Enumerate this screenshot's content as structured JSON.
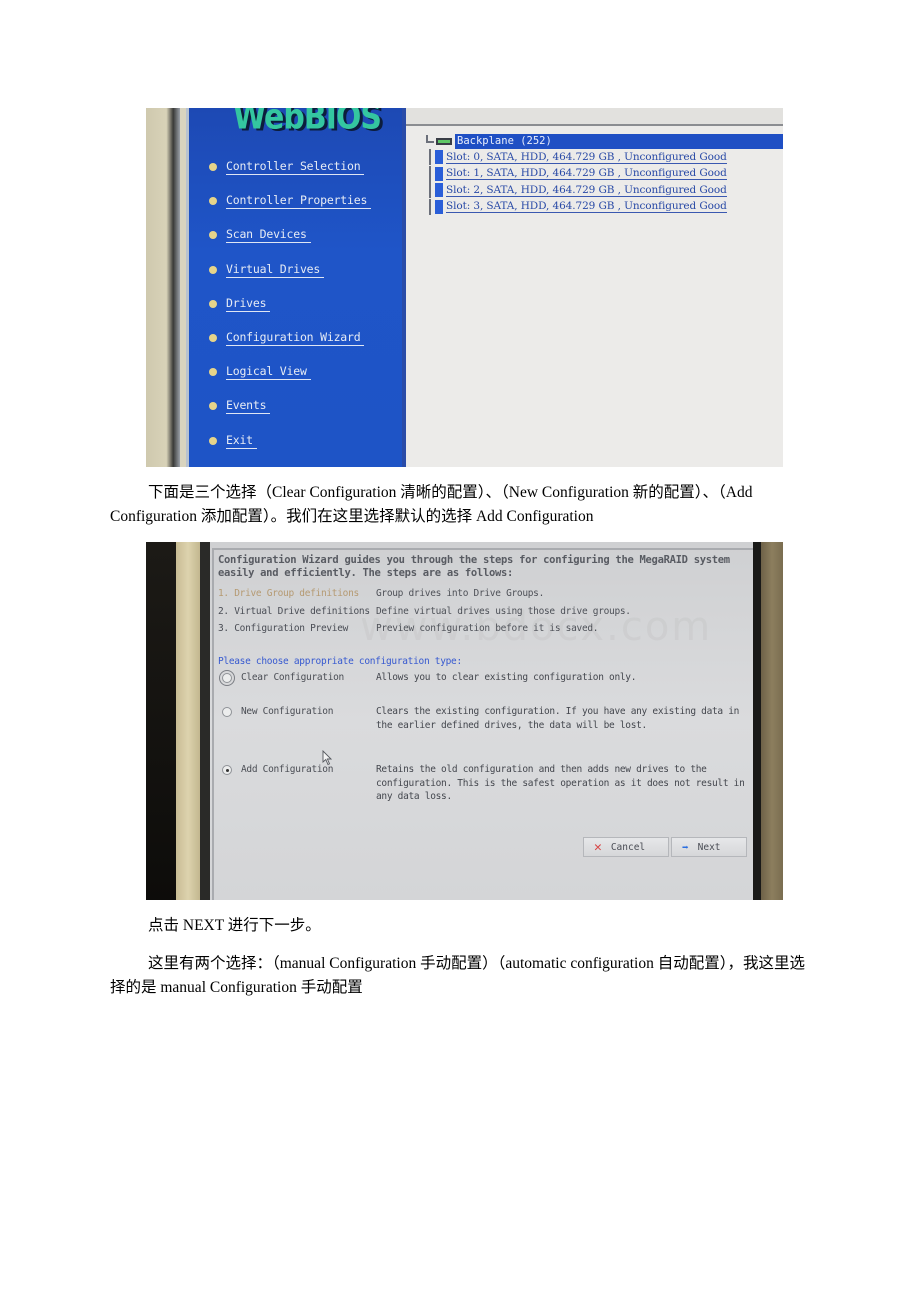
{
  "photo1": {
    "logo": "WebBIOS",
    "menu": [
      {
        "label": "Controller Selection"
      },
      {
        "label": "Controller Properties"
      },
      {
        "label": "Scan Devices"
      },
      {
        "label": "Virtual Drives"
      },
      {
        "label": "Drives"
      },
      {
        "label": "Configuration Wizard"
      },
      {
        "label": "Logical View"
      },
      {
        "label": "Events"
      },
      {
        "label": "Exit"
      }
    ],
    "tree": {
      "root": "Backplane (252)",
      "slots": [
        "Slot: 0, SATA, HDD, 464.729 GB , Unconfigured Good",
        "Slot: 1, SATA, HDD, 464.729 GB , Unconfigured Good",
        "Slot: 2, SATA, HDD, 464.729 GB , Unconfigured Good",
        "Slot: 3, SATA, HDD, 464.729 GB , Unconfigured Good"
      ]
    }
  },
  "paragraphs": {
    "choice_intro": "下面是三个选择（Clear Configuration 清晰的配置）、（New Configuration 新的配置）、（Add Configuration 添加配置）。我们在这里选择默认的选择 Add Configuration",
    "click_next": "点击 NEXT 进行下一步。",
    "two_choices": "这里有两个选择：（manual Configuration 手动配置）（automatic configuration 自动配置），我这里选择的是 manual Configuration 手动配置"
  },
  "photo2": {
    "intro": "Configuration Wizard guides you through the steps for configuring the MegaRAID system easily and efficiently. The steps are as follows:",
    "steps": [
      {
        "name": "1. Drive Group definitions",
        "desc": "Group drives into Drive Groups."
      },
      {
        "name": "2. Virtual Drive definitions",
        "desc": "Define virtual drives using those drive groups."
      },
      {
        "name": "3. Configuration Preview",
        "desc": "Preview configuration before it is saved."
      }
    ],
    "choose_label": "Please choose appropriate configuration type:",
    "options": [
      {
        "name": "Clear Configuration",
        "desc": "Allows you to clear existing configuration only.",
        "selected": false
      },
      {
        "name": "New Configuration",
        "desc": "Clears the existing configuration. If you have any existing data in the earlier defined drives, the data will be lost.",
        "selected": false
      },
      {
        "name": "Add Configuration",
        "desc": "Retains the old configuration and then adds new drives to the configuration. This is the safest operation as it does not result in any data loss.",
        "selected": true
      }
    ],
    "buttons": {
      "cancel": "Cancel",
      "next": "Next"
    },
    "watermark": "www.bdocx.com"
  }
}
